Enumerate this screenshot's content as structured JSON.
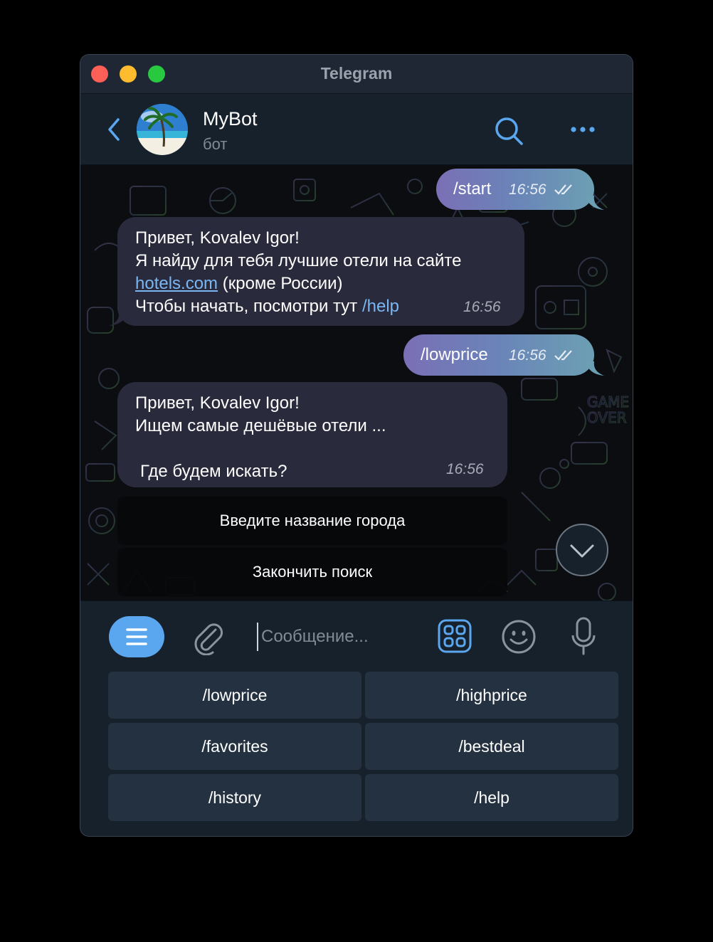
{
  "window": {
    "title": "Telegram"
  },
  "header": {
    "name": "MyBot",
    "status": "бот"
  },
  "messages": {
    "m1": {
      "text": "/start",
      "time": "16:56"
    },
    "m2": {
      "l1": "Привет, Kovalev Igor!",
      "l2": "Я найду для тебя лучшие отели на сайте",
      "l3_link": "hotels.com",
      "l3_rest": " (кроме России)",
      "l4_text": "Чтобы начать, посмотри тут ",
      "l4_link": "/help",
      "time": "16:56"
    },
    "m3": {
      "text": "/lowprice",
      "time": "16:56"
    },
    "m4": {
      "l1": "Привет, Kovalev Igor!",
      "l2": "Ищем самые дешёвые отели ...",
      "l3": "Где будем искать?",
      "time": "16:56"
    }
  },
  "inline_buttons": [
    "Введите название города",
    "Закончить поиск"
  ],
  "input": {
    "placeholder": "Сообщение..."
  },
  "keyboard": [
    "/lowprice",
    "/highprice",
    "/favorites",
    "/bestdeal",
    "/history",
    "/help"
  ]
}
